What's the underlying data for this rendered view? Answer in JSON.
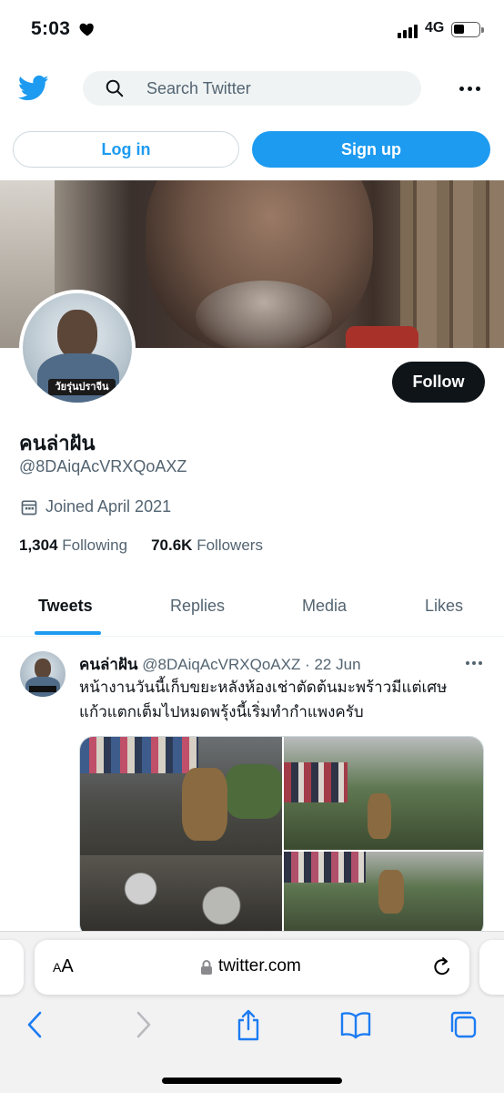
{
  "status_bar": {
    "time": "5:03",
    "network": "4G"
  },
  "header": {
    "search_placeholder": "Search Twitter"
  },
  "auth": {
    "login_label": "Log in",
    "signup_label": "Sign up"
  },
  "profile": {
    "follow_label": "Follow",
    "display_name": "คนล่าฝัน",
    "handle": "@8DAiqAcVRXQoAXZ",
    "joined": "Joined April 2021",
    "avatar_text": "วัยรุ่นปราจีน",
    "following_count": "1,304",
    "following_label": "Following",
    "followers_count": "70.6K",
    "followers_label": "Followers"
  },
  "tabs": [
    {
      "label": "Tweets",
      "active": true
    },
    {
      "label": "Replies",
      "active": false
    },
    {
      "label": "Media",
      "active": false
    },
    {
      "label": "Likes",
      "active": false
    }
  ],
  "tweet": {
    "name": "คนล่าฝัน",
    "meta": "@8DAiqAcVRXQoAXZ · 22 Jun",
    "text_line1": "หน้างานวันนี้เก็บขยะหลังห้องเช่าตัดต้นมะพร้าวมีแต่เศษ",
    "text_line2": "แก้วแตกเต็มไปหมดพรุ้งนี้เริ่มทำกำแพงครับ"
  },
  "browser": {
    "aa_small": "A",
    "aa_large": "A",
    "url": "twitter.com"
  },
  "colors": {
    "accent": "#1d9bf0",
    "text": "#0f1419",
    "secondary": "#536471"
  },
  "icons": [
    "heart-icon",
    "signal-icon",
    "battery-icon",
    "twitter-logo-icon",
    "search-icon",
    "more-icon",
    "calendar-icon",
    "lock-icon",
    "reload-icon",
    "back-icon",
    "forward-icon",
    "share-icon",
    "bookmarks-icon",
    "tabs-icon"
  ]
}
